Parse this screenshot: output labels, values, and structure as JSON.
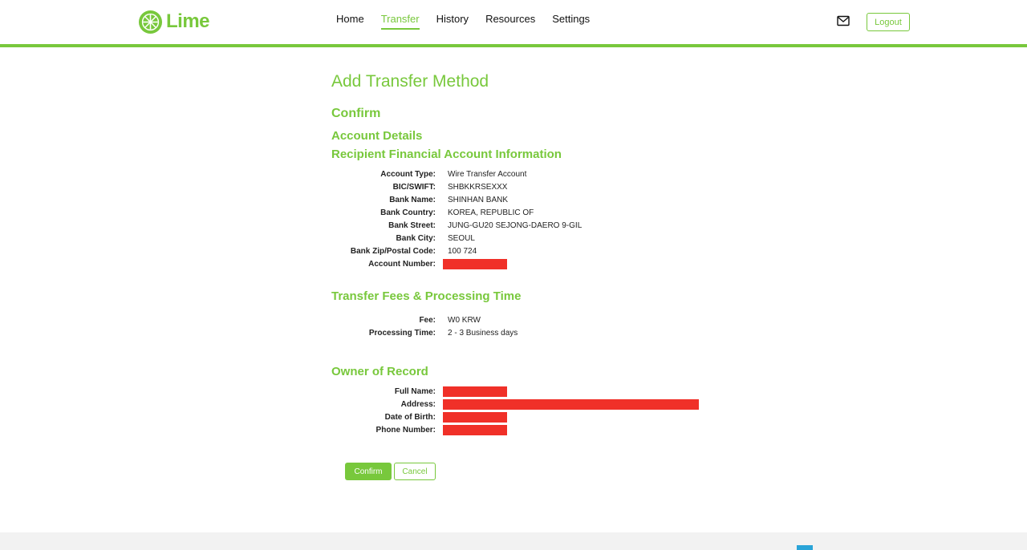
{
  "brand": {
    "name": "Lime",
    "color": "#78c83c"
  },
  "nav": {
    "items": [
      {
        "label": "Home"
      },
      {
        "label": "Transfer"
      },
      {
        "label": "History"
      },
      {
        "label": "Resources"
      },
      {
        "label": "Settings"
      }
    ],
    "active": "Transfer"
  },
  "header": {
    "mail_icon": "envelope-icon",
    "logout_label": "Logout"
  },
  "page": {
    "title": "Add Transfer Method",
    "step": "Confirm",
    "section_account": "Account Details",
    "section_recipient": "Recipient Financial Account Information",
    "section_fees": "Transfer Fees & Processing Time",
    "section_owner": "Owner of Record"
  },
  "account_rows": [
    {
      "label": "Account Type:",
      "value": "Wire Transfer Account"
    },
    {
      "label": "BIC/SWIFT:",
      "value": "SHBKKRSEXXX"
    },
    {
      "label": "Bank Name:",
      "value": "SHINHAN BANK"
    },
    {
      "label": "Bank Country:",
      "value": "KOREA, REPUBLIC OF"
    },
    {
      "label": "Bank Street:",
      "value": "JUNG-GU20 SEJONG-DAERO 9-GIL"
    },
    {
      "label": "Bank City:",
      "value": "SEOUL"
    },
    {
      "label": "Bank Zip/Postal Code:",
      "value": "100 724"
    },
    {
      "label": "Account Number:",
      "value": ""
    }
  ],
  "fee_rows": [
    {
      "label": "Fee:",
      "value": "W0 KRW"
    },
    {
      "label": "Processing Time:",
      "value": "2 - 3 Business days"
    }
  ],
  "owner_rows": [
    {
      "label": "Full Name:"
    },
    {
      "label": "Address:"
    },
    {
      "label": "Date of Birth:"
    },
    {
      "label": "Phone Number:"
    }
  ],
  "actions": {
    "confirm_label": "Confirm",
    "cancel_label": "Cancel"
  },
  "redaction_color": "#f03028"
}
